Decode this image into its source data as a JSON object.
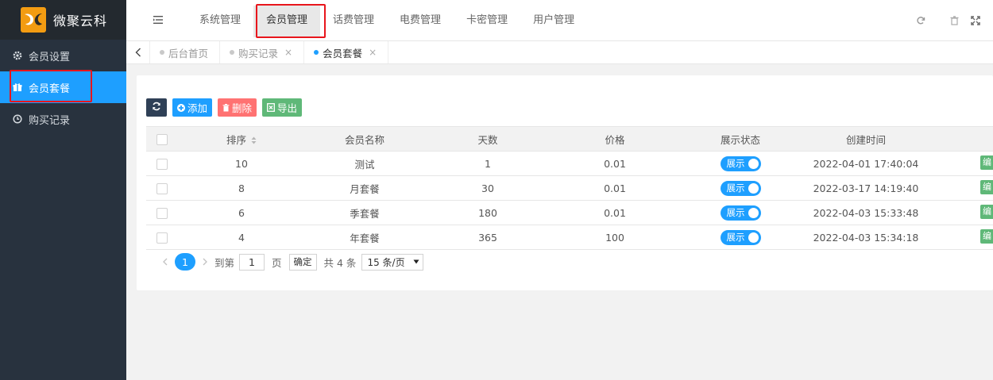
{
  "app": {
    "brand_name": "微聚云科",
    "accent_color": "#1e9fff",
    "brand_color": "#f39c12"
  },
  "sidebar": {
    "items": [
      {
        "label": "会员设置",
        "icon": "gear-icon"
      },
      {
        "label": "会员套餐",
        "icon": "gift-icon"
      },
      {
        "label": "购买记录",
        "icon": "clock-icon"
      }
    ]
  },
  "header": {
    "nav": [
      {
        "label": "系统管理"
      },
      {
        "label": "会员管理"
      },
      {
        "label": "话费管理"
      },
      {
        "label": "电费管理"
      },
      {
        "label": "卡密管理"
      },
      {
        "label": "用户管理"
      }
    ]
  },
  "tabs": [
    {
      "label": "后台首页"
    },
    {
      "label": "购买记录",
      "close": "×"
    },
    {
      "label": "会员套餐",
      "close": "×"
    }
  ],
  "toolbar": {
    "add_label": "添加",
    "delete_label": "删除",
    "export_label": "导出"
  },
  "table": {
    "headers": {
      "sort": "排序",
      "name": "会员名称",
      "days": "天数",
      "price": "价格",
      "status": "展示状态",
      "created": "创建时间"
    },
    "rows": [
      {
        "sort": "10",
        "name": "测试",
        "days": "1",
        "price": "0.01",
        "status": "展示",
        "created": "2022-04-01 17:40:04",
        "action": "编"
      },
      {
        "sort": "8",
        "name": "月套餐",
        "days": "30",
        "price": "0.01",
        "status": "展示",
        "created": "2022-03-17 14:19:40",
        "action": "编"
      },
      {
        "sort": "6",
        "name": "季套餐",
        "days": "180",
        "price": "0.01",
        "status": "展示",
        "created": "2022-04-03 15:33:48",
        "action": "编"
      },
      {
        "sort": "4",
        "name": "年套餐",
        "days": "365",
        "price": "100",
        "status": "展示",
        "created": "2022-04-03 15:34:18",
        "action": "编"
      }
    ]
  },
  "pager": {
    "current_page": "1",
    "goto_label": "到第",
    "page_input": "1",
    "page_unit": "页",
    "confirm_label": "确定",
    "total_text": "共 4 条",
    "page_size": "15 条/页"
  }
}
